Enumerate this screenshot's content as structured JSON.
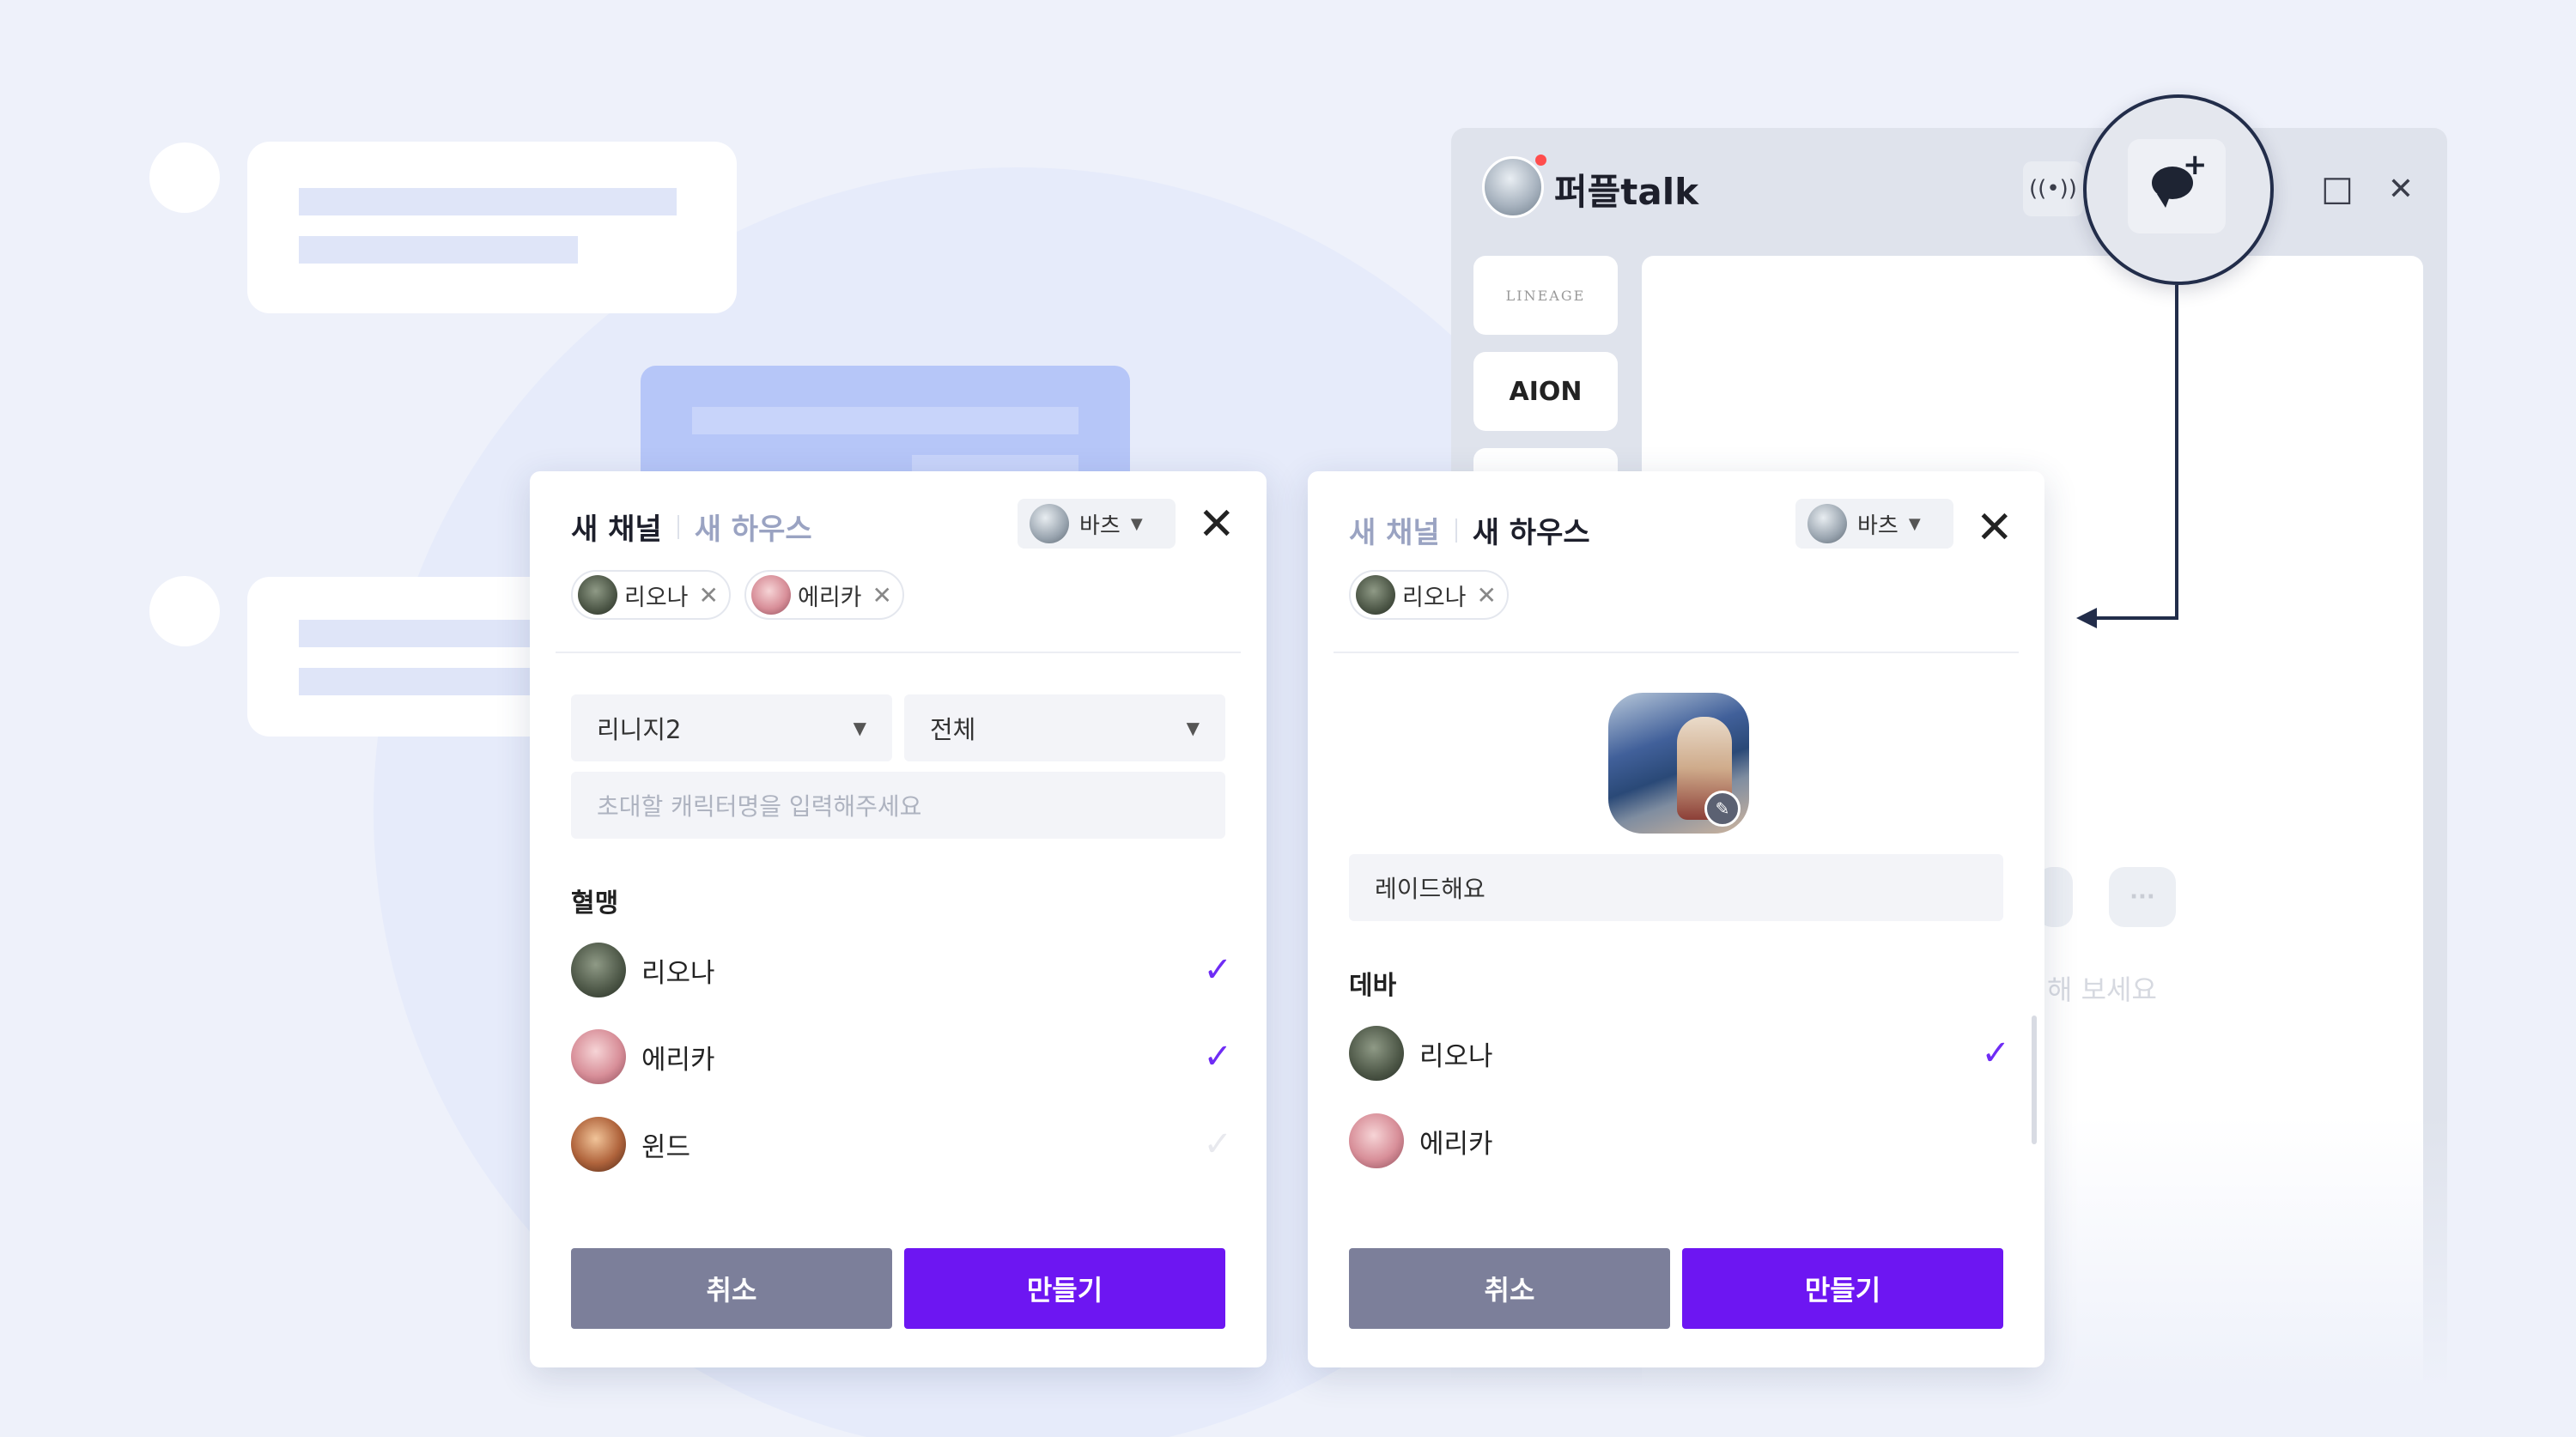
{
  "app": {
    "title": "퍼플talk",
    "games": [
      "LINEAGE",
      "AION"
    ],
    "content_hint": "해 보세요",
    "more_icon_text": "···"
  },
  "left_dialog": {
    "tabs": [
      "새 채널",
      "새 하우스"
    ],
    "active_tab": "새 채널",
    "character": "바츠",
    "chips": [
      "리오나",
      "에리카"
    ],
    "game_select": "리니지2",
    "scope_select": "전체",
    "search_placeholder": "초대할 캐릭터명을 입력해주세요",
    "section_title": "혈맹",
    "members": [
      {
        "name": "리오나",
        "checked": true
      },
      {
        "name": "에리카",
        "checked": true
      },
      {
        "name": "윈드",
        "checked": false
      }
    ],
    "cancel_label": "취소",
    "create_label": "만들기"
  },
  "right_dialog": {
    "tabs": [
      "새 채널",
      "새 하우스"
    ],
    "active_tab": "새 하우스",
    "character": "바츠",
    "chips": [
      "리오나"
    ],
    "house_name": "레이드해요",
    "section_title": "데바",
    "members": [
      {
        "name": "리오나",
        "checked": true
      },
      {
        "name": "에리카",
        "checked": false
      }
    ],
    "cancel_label": "취소",
    "create_label": "만들기"
  },
  "icons": {
    "check": "✓",
    "close": "✕",
    "caret": "▼",
    "radio": "((•))",
    "maximize": "□",
    "edit": "✎"
  },
  "colors": {
    "accent": "#6d16f2",
    "cancel": "#7c7f9a",
    "background": "#eef1fa"
  }
}
